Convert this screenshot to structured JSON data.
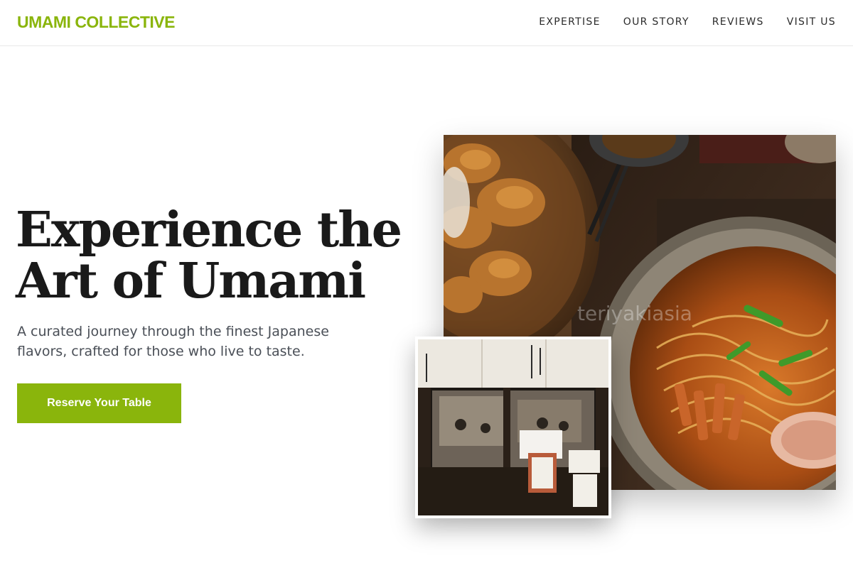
{
  "header": {
    "brand": "UMAMI COLLECTIVE",
    "nav": [
      {
        "label": "EXPERTISE"
      },
      {
        "label": "OUR STORY"
      },
      {
        "label": "REVIEWS"
      },
      {
        "label": "VISIT US"
      }
    ]
  },
  "hero": {
    "title_line1": "Experience the",
    "title_line2": "Art of Umami",
    "subtitle": "A curated journey through the finest Japanese flavors, crafted for those who live to taste.",
    "cta_label": "Reserve Your Table"
  },
  "gallery": {
    "main_photo_watermark": "teriyakiasia"
  },
  "colors": {
    "accent": "#8ab50c",
    "text_dark": "#1a1a1a",
    "text_muted": "#4a4f57"
  }
}
